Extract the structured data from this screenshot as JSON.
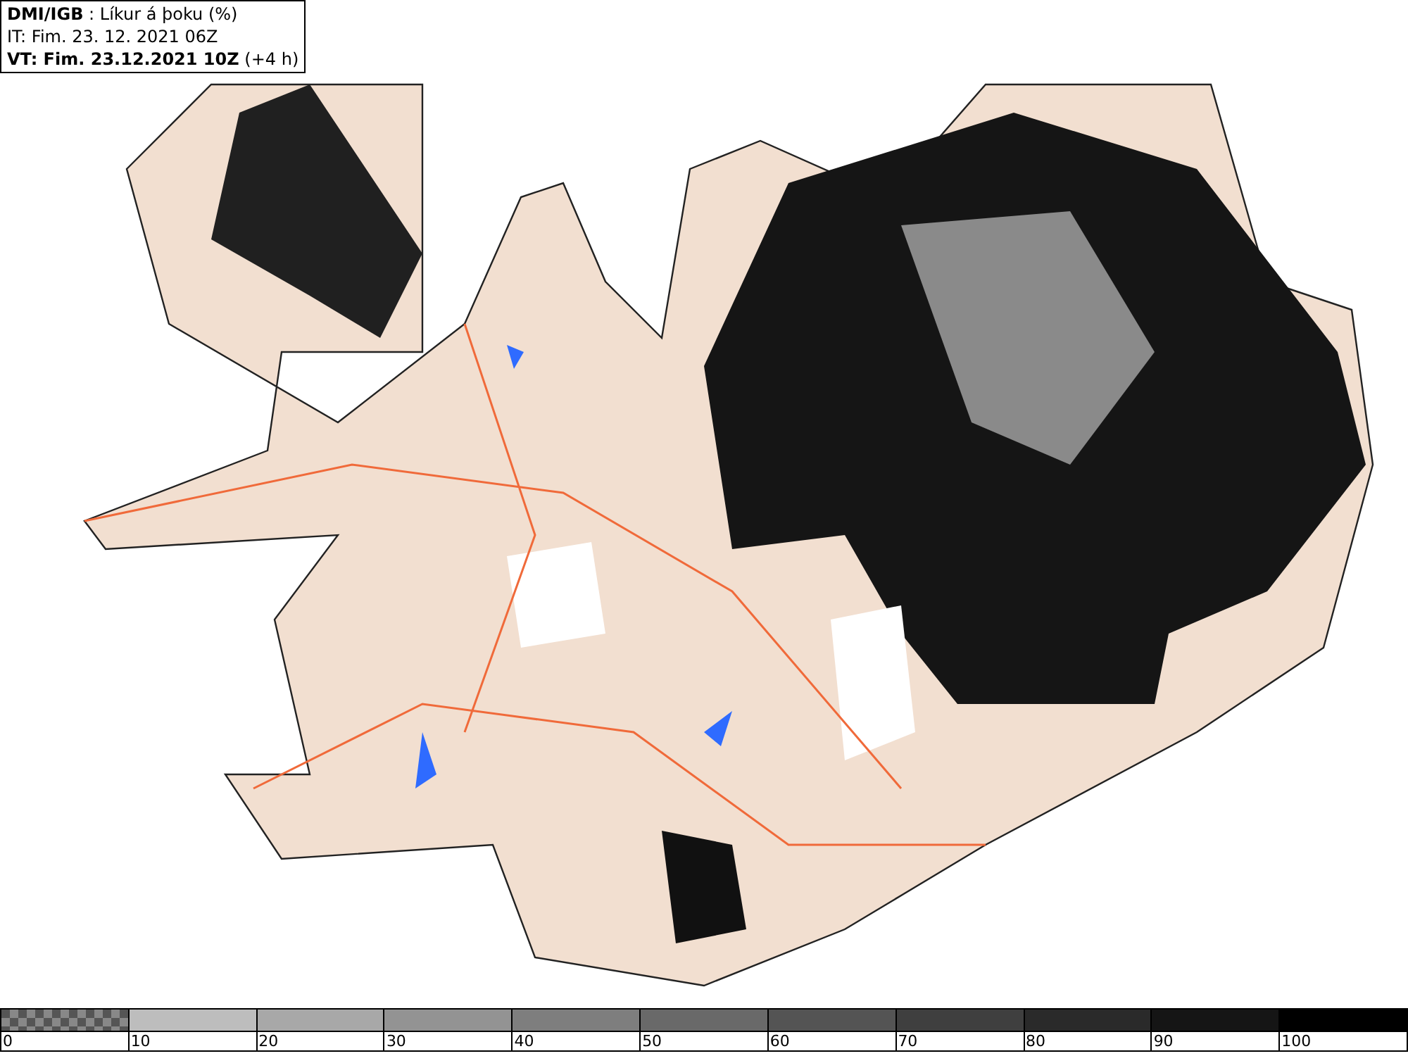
{
  "header": {
    "lines": [
      "**DMI/IGB** : Líkur á þoku (%)",
      "IT: Fim. 23. 12. 2021 06Z",
      "**VT: Fim. 23.12.2021 10Z** (+4 h)"
    ]
  },
  "legend": {
    "segments": [
      {
        "kind": "checker",
        "color": "#555555",
        "label": "0"
      },
      {
        "kind": "solid",
        "color": "#bdbdbd",
        "label": "10"
      },
      {
        "kind": "solid",
        "color": "#a8a8a8",
        "label": "20"
      },
      {
        "kind": "solid",
        "color": "#939393",
        "label": "30"
      },
      {
        "kind": "solid",
        "color": "#7e7e7e",
        "label": "40"
      },
      {
        "kind": "solid",
        "color": "#696969",
        "label": "50"
      },
      {
        "kind": "solid",
        "color": "#545454",
        "label": "60"
      },
      {
        "kind": "solid",
        "color": "#3f3f3f",
        "label": "70"
      },
      {
        "kind": "solid",
        "color": "#2a2a2a",
        "label": "80"
      },
      {
        "kind": "solid",
        "color": "#151515",
        "label": "90"
      },
      {
        "kind": "solid",
        "color": "#000000",
        "label": "100"
      }
    ]
  }
}
